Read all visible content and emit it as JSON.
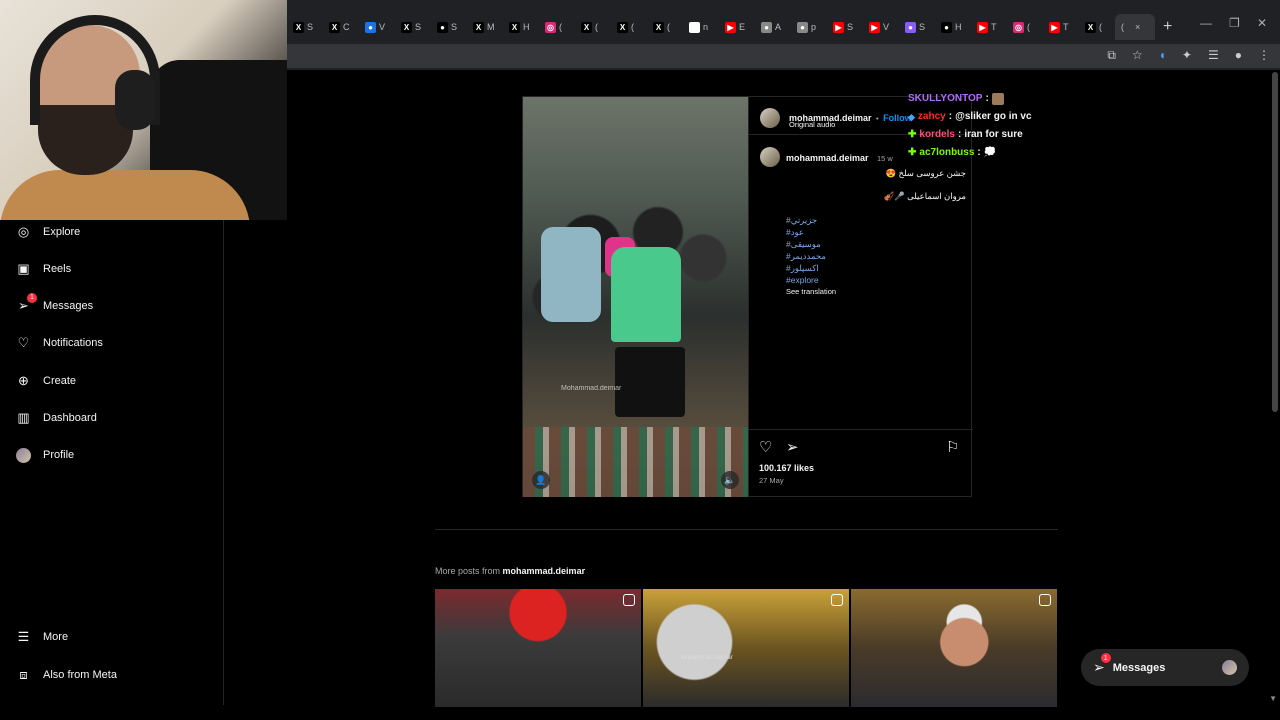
{
  "browser": {
    "tabs": [
      {
        "icon": "x-icon",
        "label": "S",
        "color": "#000000"
      },
      {
        "icon": "x-icon",
        "label": "C",
        "color": "#000000"
      },
      {
        "icon": "generic-icon",
        "label": "V",
        "color": "#1a73e8"
      },
      {
        "icon": "x-icon",
        "label": "S",
        "color": "#000000"
      },
      {
        "icon": "ghost-icon",
        "label": "S",
        "color": "#000000"
      },
      {
        "icon": "x-icon",
        "label": "M",
        "color": "#000000"
      },
      {
        "icon": "x-icon",
        "label": "H",
        "color": "#000000"
      },
      {
        "icon": "instagram-icon",
        "label": "(",
        "color": "#d62976"
      },
      {
        "icon": "x-icon",
        "label": "(",
        "color": "#000000"
      },
      {
        "icon": "x-icon",
        "label": "(",
        "color": "#000000"
      },
      {
        "icon": "x-icon",
        "label": "(",
        "color": "#000000"
      },
      {
        "icon": "google-icon",
        "label": "n",
        "color": "#ffffff"
      },
      {
        "icon": "youtube-icon",
        "label": "E",
        "color": "#ff0000"
      },
      {
        "icon": "globe-icon",
        "label": "A",
        "color": "#888888"
      },
      {
        "icon": "globe-icon",
        "label": "p",
        "color": "#888888"
      },
      {
        "icon": "youtube-icon",
        "label": "S",
        "color": "#ff0000"
      },
      {
        "icon": "youtube-icon",
        "label": "V",
        "color": "#ff0000"
      },
      {
        "icon": "feather-icon",
        "label": "S",
        "color": "#8a5cf6"
      },
      {
        "icon": "tiktok-icon",
        "label": "H",
        "color": "#000000"
      },
      {
        "icon": "youtube-icon",
        "label": "T",
        "color": "#ff0000"
      },
      {
        "icon": "instagram-icon",
        "label": "(",
        "color": "#d62976"
      },
      {
        "icon": "youtube-icon",
        "label": "T",
        "color": "#ff0000"
      },
      {
        "icon": "x-icon",
        "label": "(",
        "color": "#000000"
      }
    ],
    "active_tab_label": "(",
    "close_glyph": "×",
    "new_tab_glyph": "+"
  },
  "sidebar": {
    "items": [
      {
        "name": "explore",
        "label": "Explore",
        "icon": "compass-icon"
      },
      {
        "name": "reels",
        "label": "Reels",
        "icon": "reels-icon"
      },
      {
        "name": "messages",
        "label": "Messages",
        "icon": "messenger-icon",
        "badge": "1"
      },
      {
        "name": "notifications",
        "label": "Notifications",
        "icon": "heart-icon"
      },
      {
        "name": "create",
        "label": "Create",
        "icon": "plus-square-icon"
      },
      {
        "name": "dashboard",
        "label": "Dashboard",
        "icon": "chart-icon"
      },
      {
        "name": "profile",
        "label": "Profile",
        "icon": "avatar"
      }
    ],
    "more_label": "More",
    "meta_label": "Also from Meta"
  },
  "post": {
    "username": "mohammad.deimar",
    "follow_label": "Follow",
    "separator": "•",
    "audio": "Original audio",
    "time_ago": "15 w",
    "caption_line1": "جشن عروسی سلخ 😍",
    "caption_line2": "مروان اسماعیلی 🎤🎻",
    "hashtags": [
      "#جزيرتي",
      "#عود",
      "#موسيقى",
      "#محمدديمر",
      "#اکسپلور",
      "#explore"
    ],
    "see_translation": "See translation",
    "likes": "100.167 likes",
    "date": "27 May",
    "watermark": "Mohammad.deimar"
  },
  "chat": [
    {
      "user": "SKULLYONTOP",
      "user_color": "#b06cff",
      "message": "",
      "has_emote": true,
      "badge": ""
    },
    {
      "user": "zahcy",
      "user_color": "#ff2b2b",
      "message": "@sliker go in vc",
      "has_emote": false,
      "badge": "vip"
    },
    {
      "user": "kordels",
      "user_color": "#ff4f7b",
      "message": "iran for sure",
      "has_emote": false,
      "badge": "sub"
    },
    {
      "user": "ac7lonbuss",
      "user_color": "#7cfc00",
      "message": "",
      "has_emote": true,
      "badge": "sub"
    }
  ],
  "more_posts": {
    "prefix": "More posts from",
    "username": "mohammad.deimar",
    "thumb_watermark": "Mohammad.deimar"
  },
  "messages_pill": {
    "label": "Messages",
    "badge": "1"
  },
  "colors": {
    "background": "#000000",
    "link_blue": "#0095f6",
    "badge_red": "#ff3040"
  }
}
